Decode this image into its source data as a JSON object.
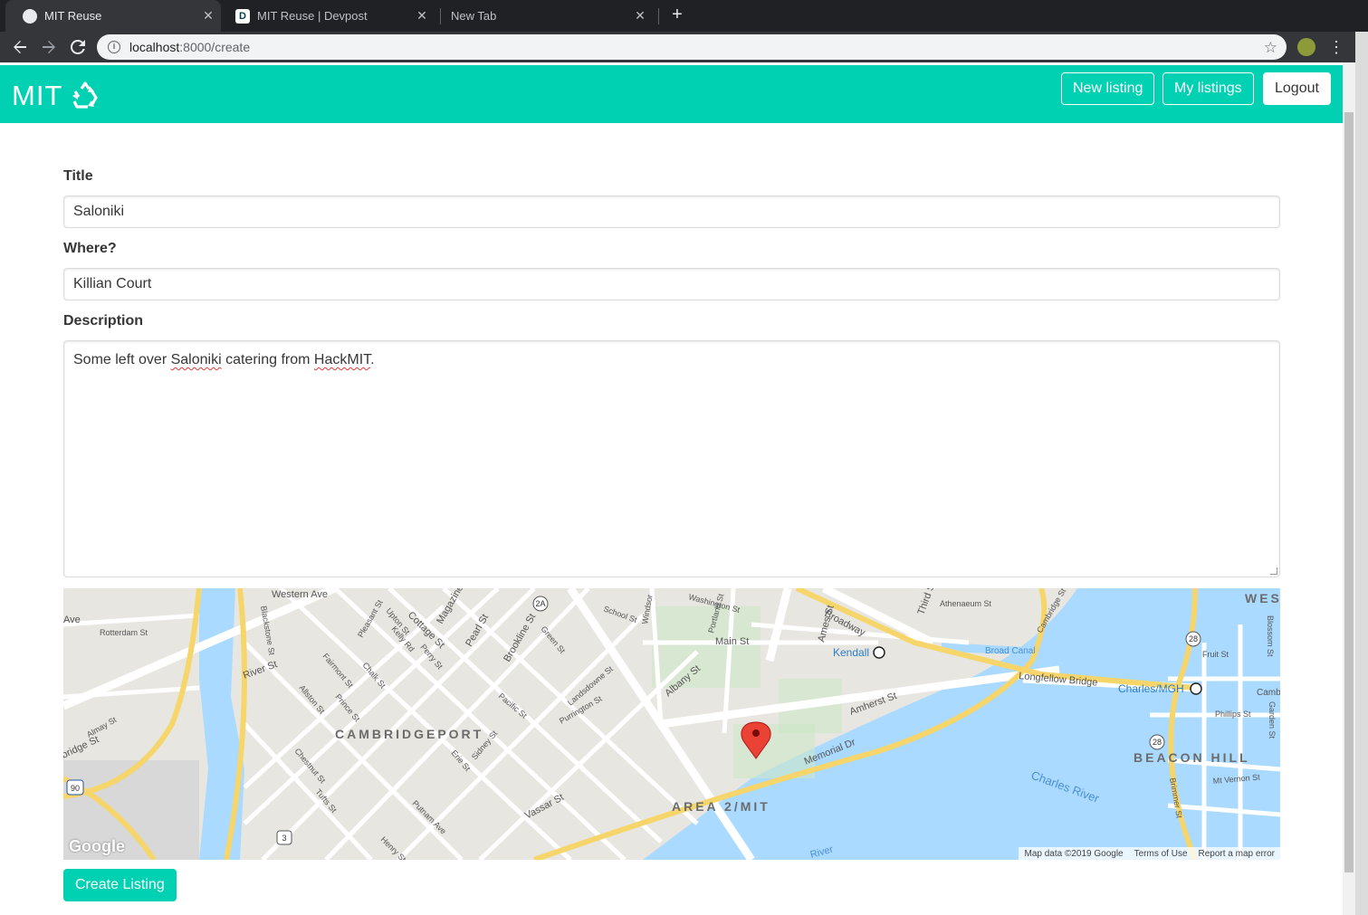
{
  "browser": {
    "tabs": [
      {
        "title": "MIT Reuse",
        "active": true
      },
      {
        "title": "MIT Reuse | Devpost",
        "active": false
      },
      {
        "title": "New Tab",
        "active": false
      }
    ],
    "url_host": "localhost",
    "url_path": ":8000/create",
    "devpost_favicon_letter": "D",
    "new_tab_symbol": "+",
    "close_symbol": "✕"
  },
  "navbar": {
    "brand": "MIT",
    "brand_icon": "recycle-icon",
    "new_listing": "New listing",
    "my_listings": "My listings",
    "logout": "Logout",
    "accent_color": "#00d1b2"
  },
  "form": {
    "title_label": "Title",
    "title_value": "Saloniki",
    "where_label": "Where?",
    "where_value": "Killian Court",
    "description_label": "Description",
    "description_parts": [
      "Some left over ",
      "Saloniki",
      " catering from ",
      "HackMIT",
      "."
    ],
    "submit_label": "Create Listing"
  },
  "map": {
    "neighborhoods": [
      "CAMBRIDGEPORT",
      "AREA 2/MIT",
      "BEACON HILL",
      "WES"
    ],
    "streets": [
      "Western Ave",
      "River St",
      "Main St",
      "Broadway",
      "Memorial Dr",
      "Longfellow Bridge",
      "Vassar St",
      "Albany St",
      "Brookline St",
      "Pearl St",
      "Magazine St",
      "Cottage St",
      "Amherst St",
      "Ames St",
      "Third St",
      "Broad Canal",
      "Charles River",
      "Ave",
      "Rotterdam St",
      "Blackstone St",
      "Fairmont St",
      "Chalk St",
      "Allston St",
      "Prince St",
      "Chestnut St",
      "Tufts St",
      "Erie St",
      "Sidney St",
      "Putnam Ave",
      "Pacific St",
      "Landsdowne St",
      "Purrington St",
      "Windsor",
      "Portland St",
      "Athenaeum St",
      "Cambridge St",
      "Fruit St",
      "Phillips St",
      "Mt Vernon St",
      "Brimmer St",
      "Blossom St",
      "Garden St",
      "Camb",
      "Almay St",
      "bridge St",
      "Kelly Rd",
      "Upton St",
      "Perry St",
      "Pleasant St",
      "Green St",
      "School St",
      "Washington St",
      "Henry St",
      "River"
    ],
    "transit_stops": [
      "Kendall",
      "Charles/MGH"
    ],
    "route_shields": [
      "2A",
      "28",
      "90",
      "3"
    ],
    "google_logo": "Google",
    "map_data": "Map data ©2019 Google",
    "terms": "Terms of Use",
    "report": "Report a map error",
    "pin_color": "#ea4335"
  }
}
